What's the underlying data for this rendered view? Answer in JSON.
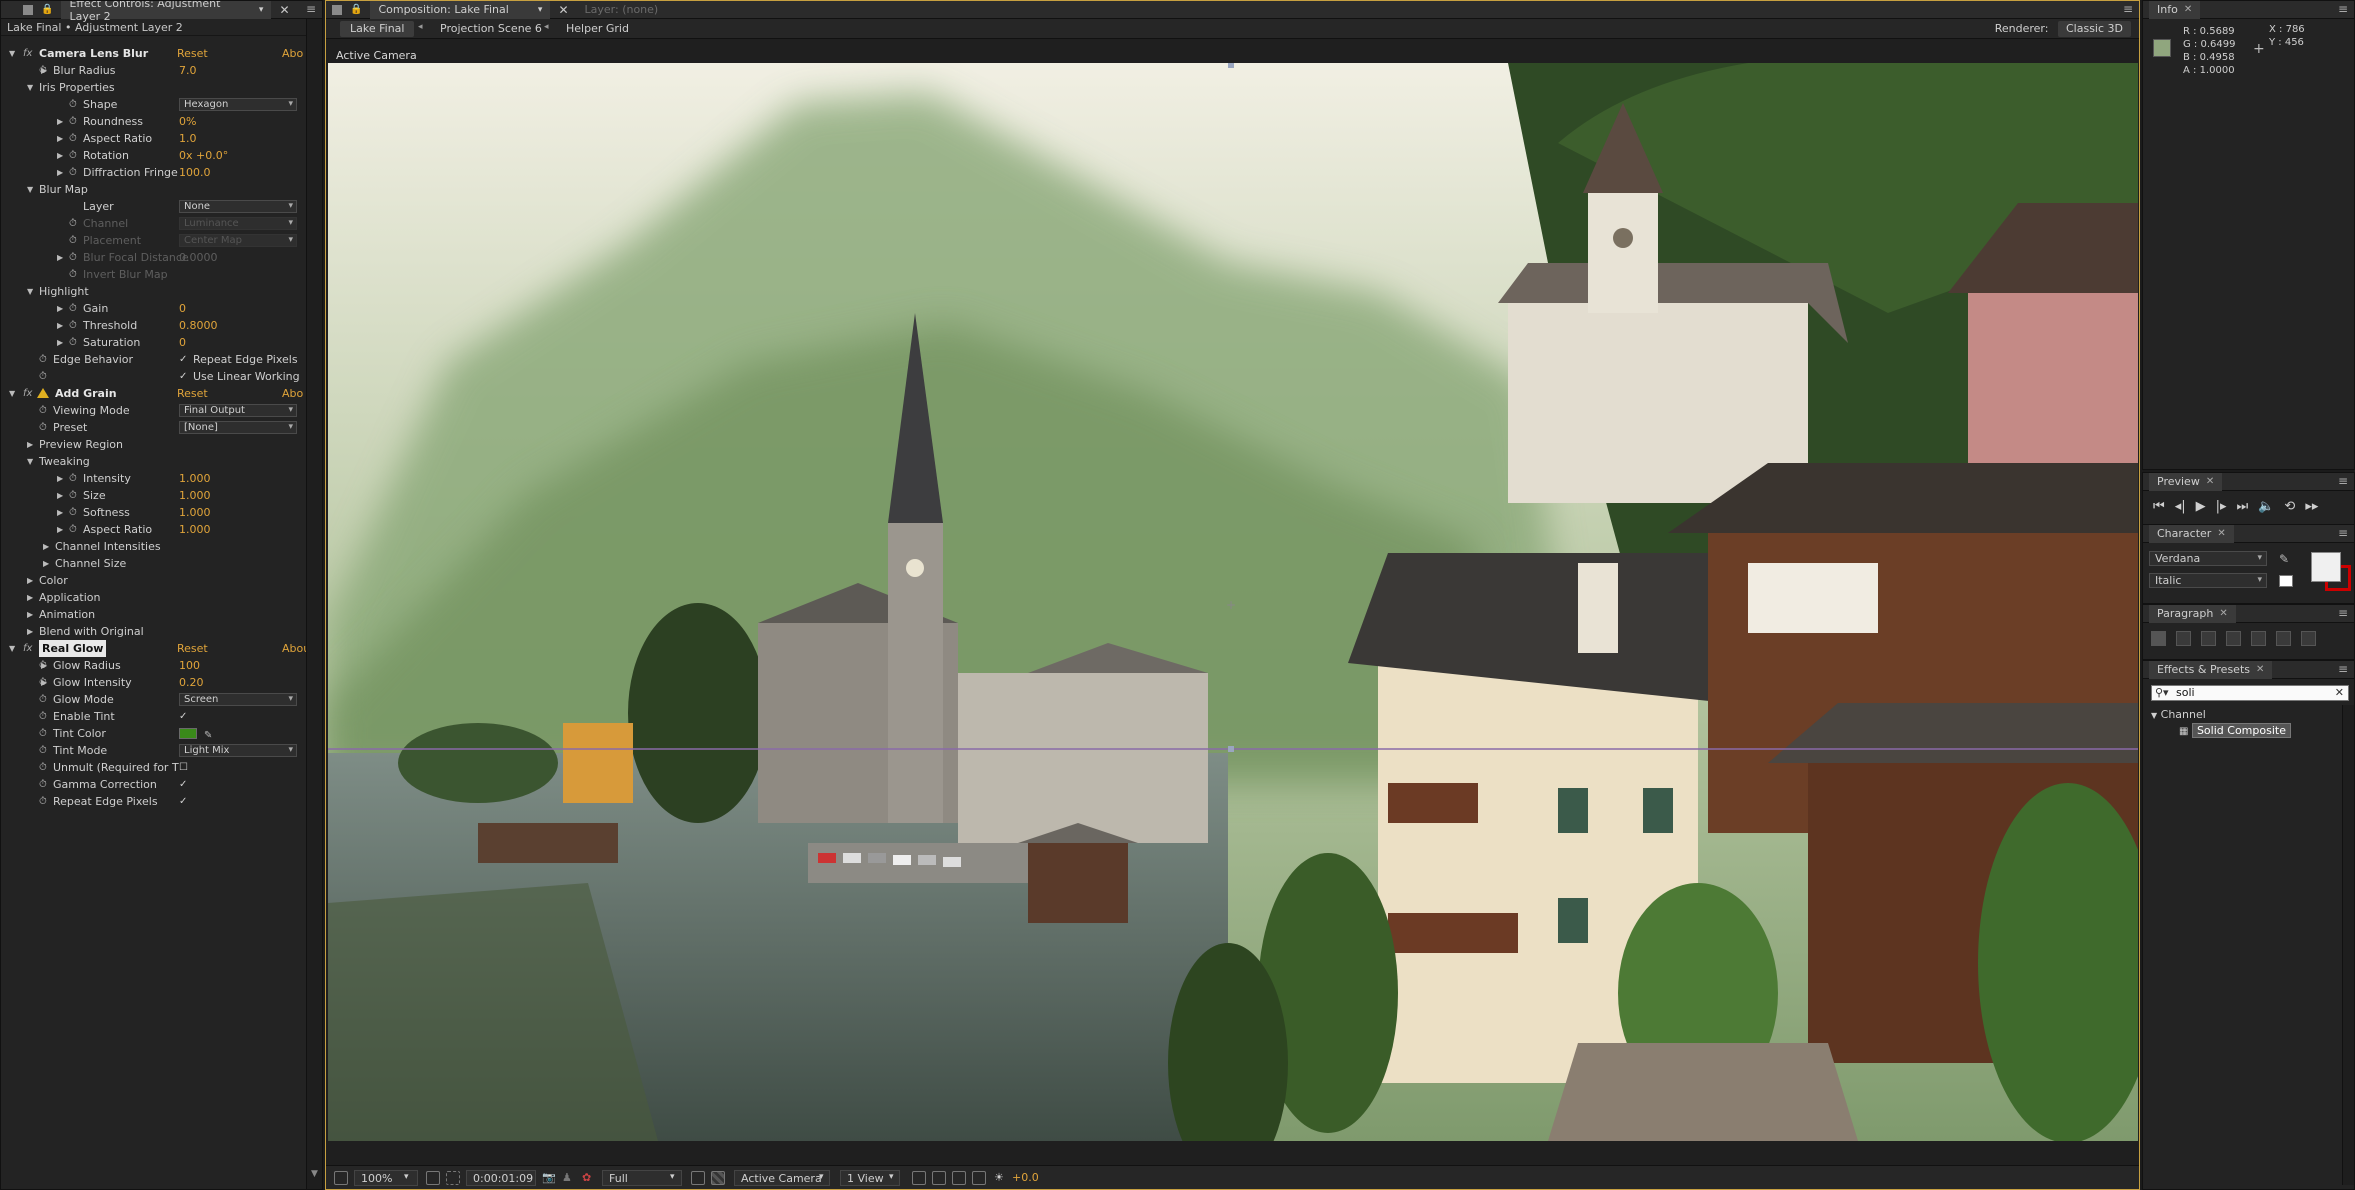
{
  "effect_controls": {
    "tab_title": "Effect Controls: Adjustment Layer 2",
    "subtitle": "Lake Final • Adjustment Layer 2",
    "rows": [
      {
        "type": "fx",
        "name": "Camera Lens Blur",
        "reset": "Reset",
        "about": "Abo"
      },
      {
        "type": "prop",
        "indent": 1,
        "name": "Blur Radius",
        "value": "7.0",
        "tri": true,
        "sw": true
      },
      {
        "type": "group",
        "indent": 1,
        "name": "Iris Properties",
        "open": true
      },
      {
        "type": "dd",
        "indent": 2,
        "name": "Shape",
        "value": "Hexagon",
        "sw": true
      },
      {
        "type": "prop",
        "indent": 2,
        "name": "Roundness",
        "value": "0%",
        "tri": true,
        "sw": true
      },
      {
        "type": "prop",
        "indent": 2,
        "name": "Aspect Ratio",
        "value": "1.0",
        "tri": true,
        "sw": true
      },
      {
        "type": "prop",
        "indent": 2,
        "name": "Rotation",
        "value": "0x +0.0°",
        "tri": true,
        "sw": true
      },
      {
        "type": "prop",
        "indent": 2,
        "name": "Diffraction Fringe",
        "value": "100.0",
        "tri": true,
        "sw": true
      },
      {
        "type": "group",
        "indent": 1,
        "name": "Blur Map",
        "open": true
      },
      {
        "type": "dd",
        "indent": 2,
        "name": "Layer",
        "value": "None",
        "sw": false
      },
      {
        "type": "dd",
        "indent": 2,
        "name": "Channel",
        "value": "Luminance",
        "sw": true,
        "dim": true
      },
      {
        "type": "dd",
        "indent": 2,
        "name": "Placement",
        "value": "Center Map",
        "sw": true,
        "dim": true
      },
      {
        "type": "prop",
        "indent": 2,
        "name": "Blur Focal Distance",
        "value": "0.0000",
        "tri": true,
        "sw": true,
        "dim": true
      },
      {
        "type": "prop",
        "indent": 2,
        "name": "Invert Blur Map",
        "value": "",
        "sw": true,
        "dim": true
      },
      {
        "type": "group",
        "indent": 1,
        "name": "Highlight",
        "open": true
      },
      {
        "type": "prop",
        "indent": 2,
        "name": "Gain",
        "value": "0",
        "tri": true,
        "sw": true
      },
      {
        "type": "prop",
        "indent": 2,
        "name": "Threshold",
        "value": "0.8000",
        "tri": true,
        "sw": true
      },
      {
        "type": "prop",
        "indent": 2,
        "name": "Saturation",
        "value": "0",
        "tri": true,
        "sw": true
      },
      {
        "type": "chk",
        "indent": 1,
        "name": "Edge Behavior",
        "value": "Repeat Edge Pixels",
        "checked": true,
        "sw": true
      },
      {
        "type": "chk",
        "indent": 1,
        "name": "",
        "value": "Use Linear Working",
        "checked": true,
        "sw": true
      },
      {
        "type": "fx",
        "name": "Add Grain",
        "reset": "Reset",
        "about": "Abo",
        "warn": true
      },
      {
        "type": "dd",
        "indent": 1,
        "name": "Viewing Mode",
        "value": "Final Output",
        "sw": true
      },
      {
        "type": "dd",
        "indent": 1,
        "name": "Preset",
        "value": "[None]",
        "sw": true
      },
      {
        "type": "group",
        "indent": 1,
        "name": "Preview Region",
        "open": false
      },
      {
        "type": "group",
        "indent": 1,
        "name": "Tweaking",
        "open": true
      },
      {
        "type": "prop",
        "indent": 2,
        "name": "Intensity",
        "value": "1.000",
        "tri": true,
        "sw": true
      },
      {
        "type": "prop",
        "indent": 2,
        "name": "Size",
        "value": "1.000",
        "tri": true,
        "sw": true
      },
      {
        "type": "prop",
        "indent": 2,
        "name": "Softness",
        "value": "1.000",
        "tri": true,
        "sw": true
      },
      {
        "type": "prop",
        "indent": 2,
        "name": "Aspect Ratio",
        "value": "1.000",
        "tri": true,
        "sw": true
      },
      {
        "type": "group",
        "indent": 2,
        "name": "Channel Intensities",
        "open": false
      },
      {
        "type": "group",
        "indent": 2,
        "name": "Channel Size",
        "open": false
      },
      {
        "type": "group",
        "indent": 1,
        "name": "Color",
        "open": false
      },
      {
        "type": "group",
        "indent": 1,
        "name": "Application",
        "open": false
      },
      {
        "type": "group",
        "indent": 1,
        "name": "Animation",
        "open": false
      },
      {
        "type": "group",
        "indent": 1,
        "name": "Blend with Original",
        "open": false
      },
      {
        "type": "fx",
        "name": "Real Glow",
        "reset": "Reset",
        "about": "About...",
        "selected": true
      },
      {
        "type": "prop",
        "indent": 1,
        "name": "Glow Radius",
        "value": "100",
        "tri": true,
        "sw": true
      },
      {
        "type": "prop",
        "indent": 1,
        "name": "Glow Intensity",
        "value": "0.20",
        "tri": true,
        "sw": true
      },
      {
        "type": "dd",
        "indent": 1,
        "name": "Glow Mode",
        "value": "Screen",
        "sw": true
      },
      {
        "type": "chk",
        "indent": 1,
        "name": "Enable Tint",
        "value": "",
        "checked": true,
        "sw": true
      },
      {
        "type": "color",
        "indent": 1,
        "name": "Tint Color",
        "sw": true
      },
      {
        "type": "dd",
        "indent": 1,
        "name": "Tint Mode",
        "value": "Light Mix",
        "sw": true
      },
      {
        "type": "chk",
        "indent": 1,
        "name": "Unmult (Required for T",
        "value": "",
        "checked": false,
        "sw": true
      },
      {
        "type": "chk",
        "indent": 1,
        "name": "Gamma Correction",
        "value": "",
        "checked": true,
        "sw": true
      },
      {
        "type": "chk",
        "indent": 1,
        "name": "Repeat Edge Pixels",
        "value": "",
        "checked": true,
        "sw": true
      }
    ]
  },
  "composition": {
    "tab_title": "Composition: Lake Final",
    "layer_tab": "Layer: (none)",
    "crumbs": [
      "Lake Final",
      "Projection Scene 6",
      "Helper Grid"
    ],
    "renderer_label": "Renderer:",
    "renderer_value": "Classic 3D",
    "camera_label": "Active Camera",
    "footer": {
      "zoom": "100%",
      "timecode": "0:00:01:09",
      "resolution": "Full",
      "camera": "Active Camera",
      "views": "1 View",
      "exposure": "+0.0"
    }
  },
  "info": {
    "tab_title": "Info",
    "r": "R : 0.5689",
    "g": "G : 0.6499",
    "b": "B : 0.4958",
    "a": "A : 1.0000",
    "x": "X : 786",
    "y": "Y : 456",
    "swatch_color": "#90a67e"
  },
  "preview": {
    "tab_title": "Preview",
    "controls": [
      "⏮",
      "◂|",
      "▶",
      "|▸",
      "⏭",
      "🔈",
      "⟲",
      "▸▸"
    ]
  },
  "character": {
    "tab_title": "Character",
    "font": "Verdana",
    "style": "Italic"
  },
  "paragraph": {
    "tab_title": "Paragraph"
  },
  "presets": {
    "tab_title": "Effects & Presets",
    "search_value": "soli",
    "category": "Channel",
    "item": "Solid Composite"
  }
}
